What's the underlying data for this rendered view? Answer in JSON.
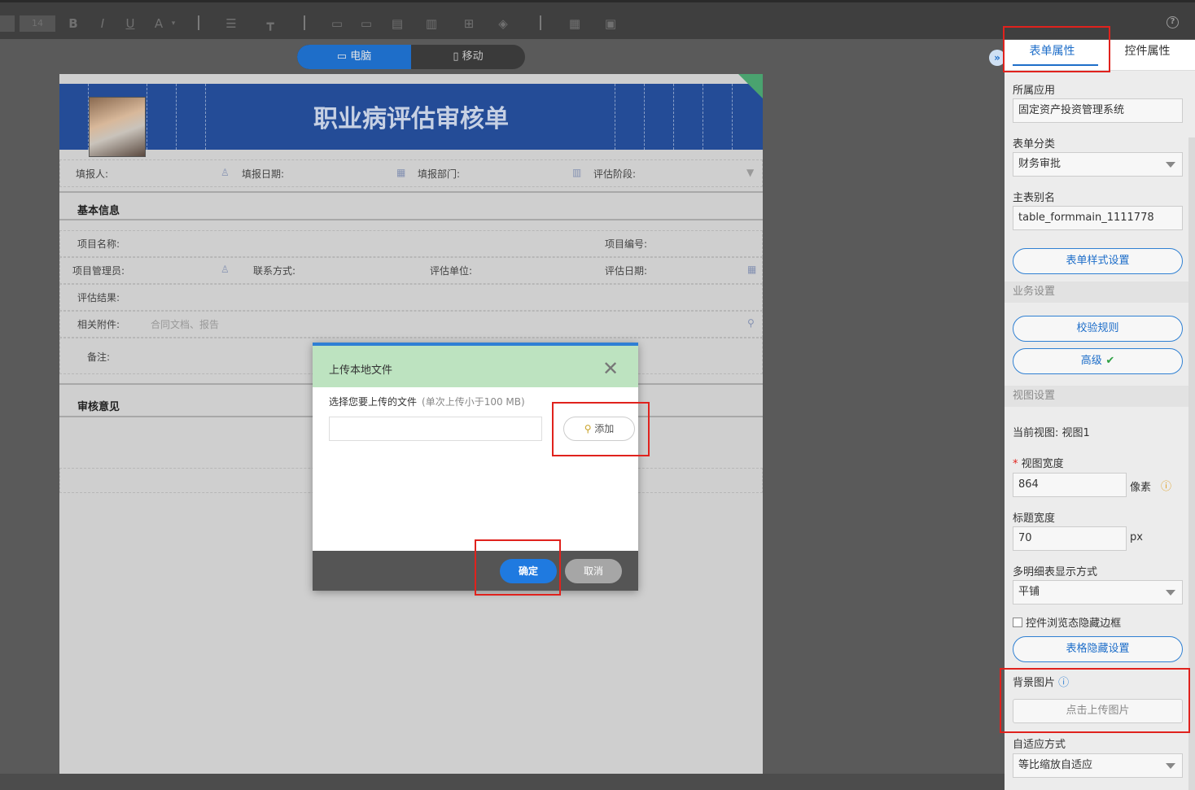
{
  "toolbar": {
    "font_size": "14",
    "buttons": [
      "B",
      "I",
      "U",
      "A"
    ],
    "help_label": "?"
  },
  "device": {
    "pc_label": "电脑",
    "mobile_label": "移动"
  },
  "form": {
    "title": "职业病评估审核单",
    "row1": [
      "填报人:",
      "填报日期:",
      "填报部门:",
      "评估阶段:"
    ],
    "section_basic": "基本信息",
    "project_name": "项目名称:",
    "project_no": "项目编号:",
    "project_manager": "项目管理员:",
    "contact": "联系方式:",
    "eval_unit": "评估单位:",
    "eval_date": "评估日期:",
    "eval_result": "评估结果:",
    "attachment": "相关附件:",
    "attachment_placeholder": "合同文档、报告",
    "remark": "备注:",
    "section_review": "审核意见"
  },
  "dialog": {
    "title": "上传本地文件",
    "prompt": "选择您要上传的文件",
    "hint": "(单次上传小于100 MB)",
    "add_label": "添加",
    "ok_label": "确定",
    "cancel_label": "取消"
  },
  "panel": {
    "tab_form": "表单属性",
    "tab_control": "控件属性",
    "app_label": "所属应用",
    "app_value": "固定资产投资管理系统",
    "category_label": "表单分类",
    "category_value": "财务审批",
    "alias_label": "主表别名",
    "alias_value": "table_formmain_1111778",
    "style_btn": "表单样式设置",
    "business_group": "业务设置",
    "validate_btn": "校验规则",
    "advanced_btn": "高级",
    "view_group": "视图设置",
    "current_view": "当前视图:  视图1",
    "view_width_label": "视图宽度",
    "view_width_value": "864",
    "view_width_unit": "像素",
    "title_width_label": "标题宽度",
    "title_width_value": "70",
    "title_width_unit": "px",
    "multi_detail_label": "多明细表显示方式",
    "multi_detail_value": "平铺",
    "hide_border_label": "控件浏览态隐藏边框",
    "table_hide_btn": "表格隐藏设置",
    "bg_label": "背景图片",
    "upload_img_btn": "点击上传图片",
    "adaptive_label": "自适应方式",
    "adaptive_value": "等比缩放自适应"
  },
  "colors": {
    "accent": "#1e6ec9",
    "header": "#244c97",
    "highlight": "#e0221d",
    "dialog_head": "#bde3c0"
  }
}
